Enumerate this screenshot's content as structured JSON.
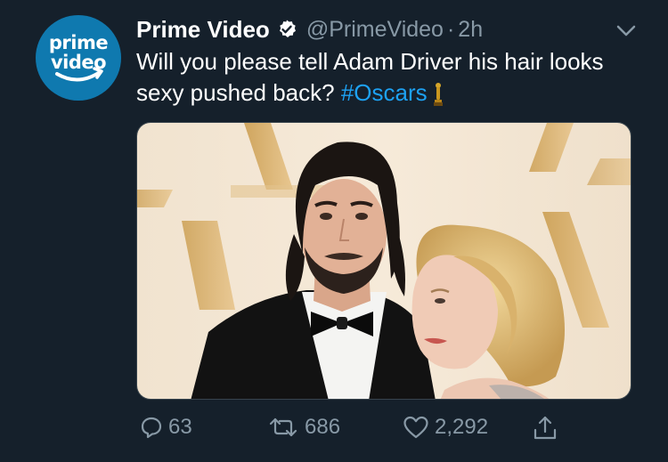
{
  "account": {
    "display_name": "Prime Video",
    "handle": "@PrimeVideo",
    "separator": "·",
    "time": "2h",
    "avatar_logo_text_line1": "prime",
    "avatar_logo_text_line2": "video",
    "verified": true
  },
  "tweet": {
    "text_part1": "Will you please tell Adam Driver his hair looks sexy pushed back? ",
    "hashtag": "#Oscars",
    "emoji": "oscar-trophy"
  },
  "media": {
    "description": "photo"
  },
  "actions": {
    "replies": "63",
    "retweets": "686",
    "likes": "2,292"
  },
  "colors": {
    "background": "#15202b",
    "secondary_text": "#8899a6",
    "link": "#1da1f2",
    "avatar_bg": "#0f79af"
  },
  "icons": [
    "verified-badge-icon",
    "chevron-down-icon",
    "reply-icon",
    "retweet-icon",
    "like-icon",
    "share-icon"
  ]
}
